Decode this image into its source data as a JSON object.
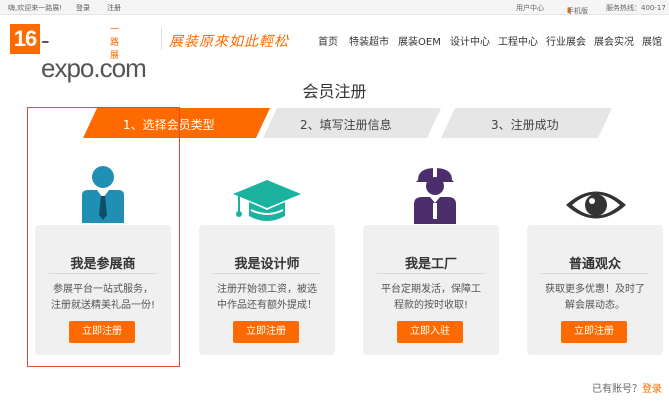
{
  "topbar": {
    "greeting": "嗨,欢迎来一路展!",
    "login": "登录",
    "register": "注册",
    "user_center": "用户中心",
    "mobile": "手机版",
    "hotline": "服务热线：400-17"
  },
  "header": {
    "logo_16": "16",
    "logo_expo": "-expo.com",
    "logo_cn": "一路展",
    "slogan": "展装原來如此輕松",
    "nav": [
      "首页",
      "特装超市",
      "展装OEM",
      "设计中心",
      "工程中心",
      "行业展会",
      "展会实况",
      "展馆"
    ]
  },
  "page_title": "会员注册",
  "steps": [
    {
      "label": "1、选择会员类型",
      "active": true
    },
    {
      "label": "2、填写注册信息",
      "active": false
    },
    {
      "label": "3、注册成功",
      "active": false
    }
  ],
  "cards": [
    {
      "icon": "exhibitor-icon",
      "title": "我是参展商",
      "desc_line1": "参展平台一站式服务，",
      "desc_line2": "注册就送精美礼品一份!",
      "button": "立即注册"
    },
    {
      "icon": "graduation-cap-icon",
      "title": "我是设计师",
      "desc_line1": "注册开始领工资，被选",
      "desc_line2": "中作品还有额外提成！",
      "button": "立即注册"
    },
    {
      "icon": "factory-worker-icon",
      "title": "我是工厂",
      "desc_line1": "平台定期发活，保障工",
      "desc_line2": "程款的按时收取!",
      "button": "立即入驻"
    },
    {
      "icon": "eye-icon",
      "title": "普通观众",
      "desc_line1": "获取更多优惠！及时了",
      "desc_line2": "解会展动态。",
      "button": "立即注册"
    }
  ],
  "footer": {
    "have_account": "已有账号？",
    "login_link": "登录"
  },
  "colors": {
    "accent": "#ff6a00",
    "step_inactive": "#e6e6e6",
    "card_bg": "#f0f0f0",
    "highlight": "#e8463b",
    "exhibitor": "#1f8fb4",
    "designer": "#1bb3a0",
    "factory": "#4b2e6b",
    "viewer": "#333333"
  }
}
